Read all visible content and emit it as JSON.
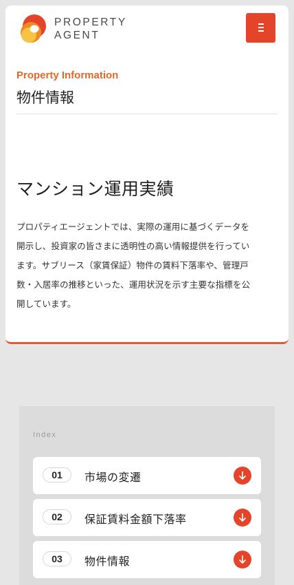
{
  "header": {
    "logo_line1": "PROPERTY",
    "logo_line2": "AGENT"
  },
  "section": {
    "eyebrow": "Property Information",
    "title": "物件情報"
  },
  "main": {
    "heading": "マンション運用実績",
    "intro": "プロパティエージェントでは、実際の運用に基づくデータを開示し、投資家の皆さまに透明性の高い情報提供を行っています。サブリース（家賃保証）物件の賃料下落率や、管理戸数・入居率の推移といった、運用状況を示す主要な指標を公開しています。"
  },
  "index": {
    "label": "Index",
    "items": [
      {
        "num": "01",
        "label": "市場の変遷"
      },
      {
        "num": "02",
        "label": "保証賃料金額下落率"
      },
      {
        "num": "03",
        "label": "物件情報"
      }
    ]
  },
  "icons": {
    "logo": "property-agent-logo-icon",
    "menu": "hamburger-menu-icon",
    "arrow": "arrow-down-icon"
  },
  "colors": {
    "accent": "#e4442a",
    "eyebrow": "#dd6a2c",
    "logo_orange": "#f08a24",
    "logo_yellow": "#f6c343"
  }
}
